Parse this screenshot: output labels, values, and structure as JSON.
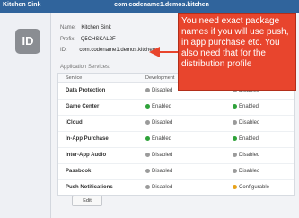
{
  "header": {
    "left_title": "Kitchen Sink",
    "center_title": "com.codename1.demos.kitchen"
  },
  "app_info": {
    "badge": "ID",
    "name_label": "Name:",
    "name_value": "Kitchen Sink",
    "prefix_label": "Prefix:",
    "prefix_value": "Q5CHSKAL2F",
    "id_label": "ID:",
    "id_value": "com.codename1.demos.kitchen"
  },
  "services": {
    "title": "Application Services:",
    "columns": [
      "Service",
      "Development",
      ""
    ],
    "rows": [
      {
        "name": "Data Protection",
        "development": "Disabled",
        "distribution": "Disabled"
      },
      {
        "name": "Game Center",
        "development": "Enabled",
        "distribution": "Enabled"
      },
      {
        "name": "iCloud",
        "development": "Disabled",
        "distribution": "Disabled"
      },
      {
        "name": "In-App Purchase",
        "development": "Enabled",
        "distribution": "Enabled"
      },
      {
        "name": "Inter-App Audio",
        "development": "Disabled",
        "distribution": "Disabled"
      },
      {
        "name": "Passbook",
        "development": "Disabled",
        "distribution": "Disabled"
      },
      {
        "name": "Push Notifications",
        "development": "Disabled",
        "distribution": "Configurable"
      }
    ]
  },
  "colors": {
    "enabled": "#2fa23a",
    "disabled": "#9b9b9b",
    "configurable": "#e7a21a"
  },
  "edit_button": "Edit",
  "callout": {
    "text": "You need exact package names if you will use push, in app purchase etc. You also need that for the distribution profile"
  }
}
